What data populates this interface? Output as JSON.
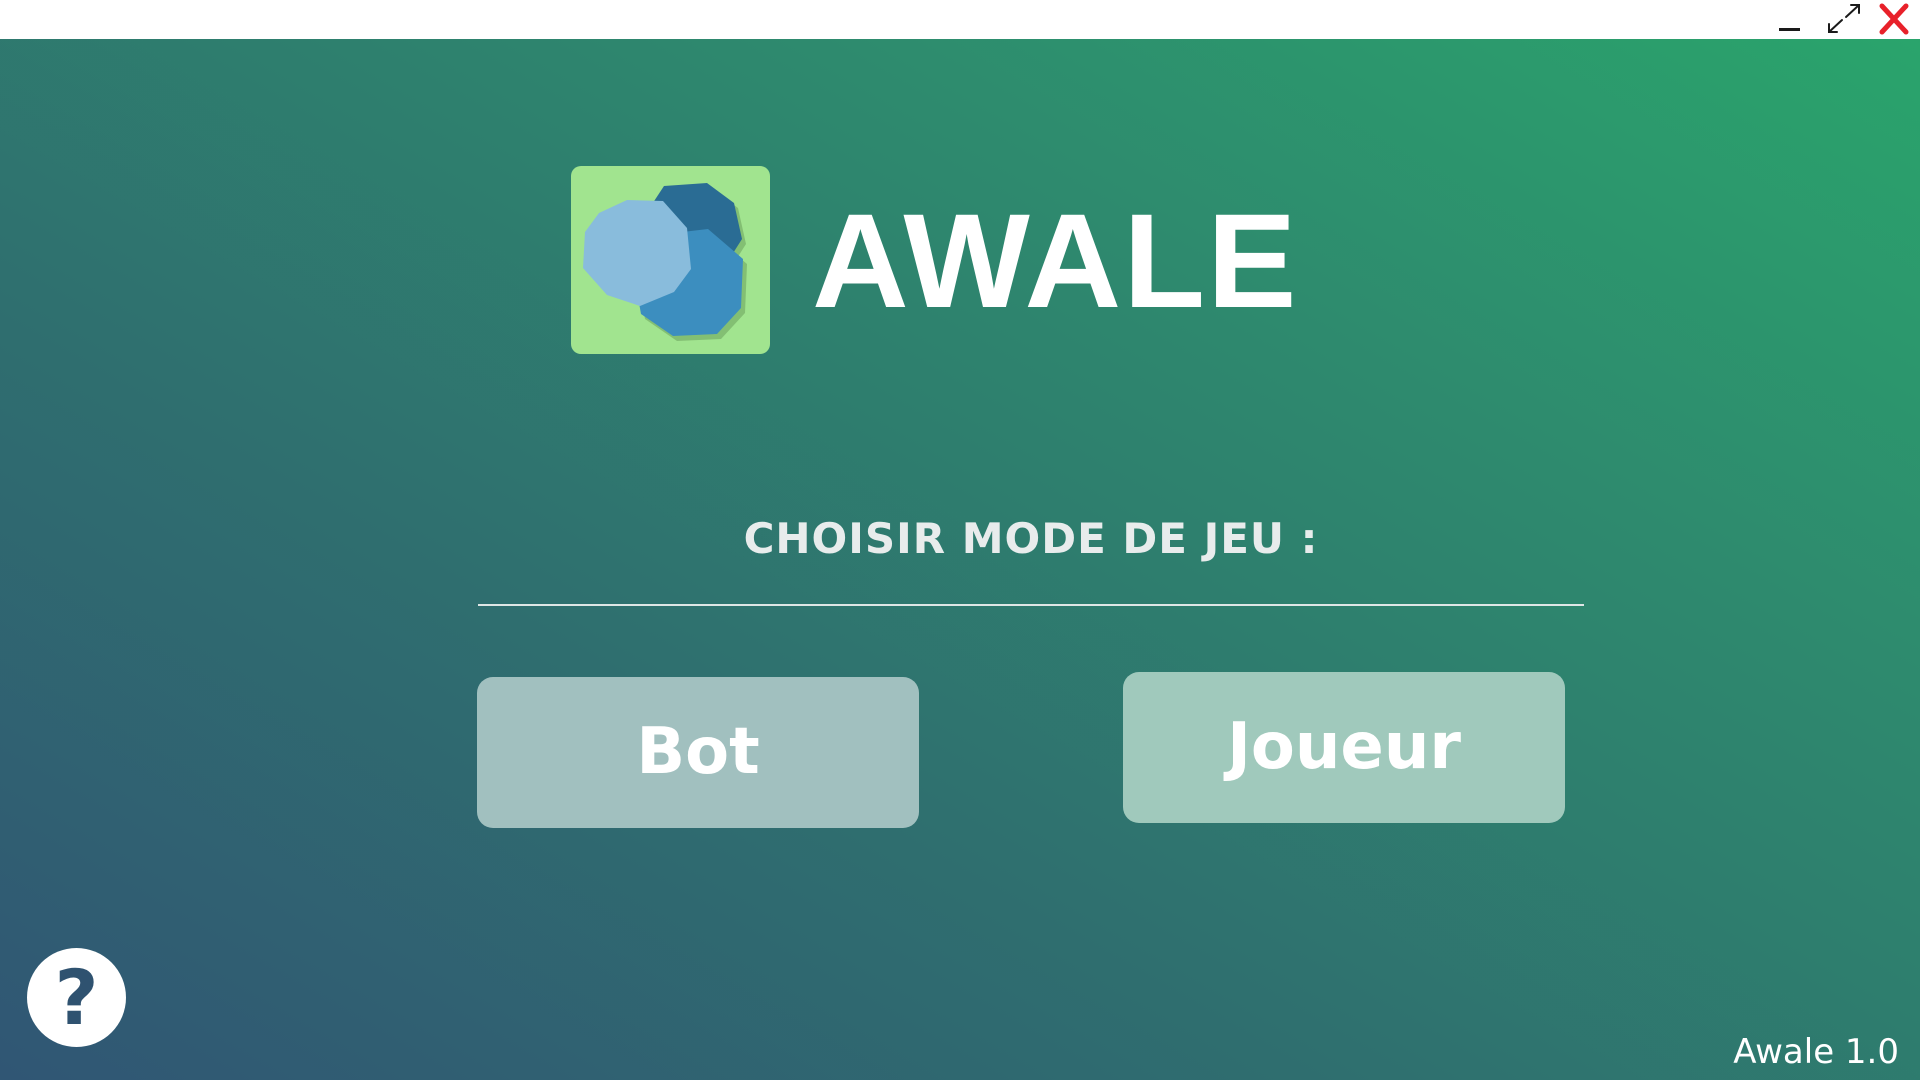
{
  "window": {
    "controls": {
      "minimize_icon": "minimize-icon",
      "maximize_icon": "maximize-arrows-icon",
      "close_icon": "close-x-icon",
      "close_color": "#e8212a"
    }
  },
  "app": {
    "title": "AWALE",
    "logo": {
      "icon": "awale-seeds-logo",
      "background_color": "#a1e48f"
    },
    "mode_heading": "CHOISIR MODE DE JEU :",
    "buttons": {
      "bot_label": "Bot",
      "joueur_label": "Joueur"
    },
    "help": {
      "label": "?",
      "icon": "help-question-icon"
    },
    "version": "Awale 1.0"
  },
  "colors": {
    "gradient_start": "#305674",
    "gradient_end": "#2aa46c",
    "text": "#ffffff",
    "help_glyph": "#2f5270"
  }
}
